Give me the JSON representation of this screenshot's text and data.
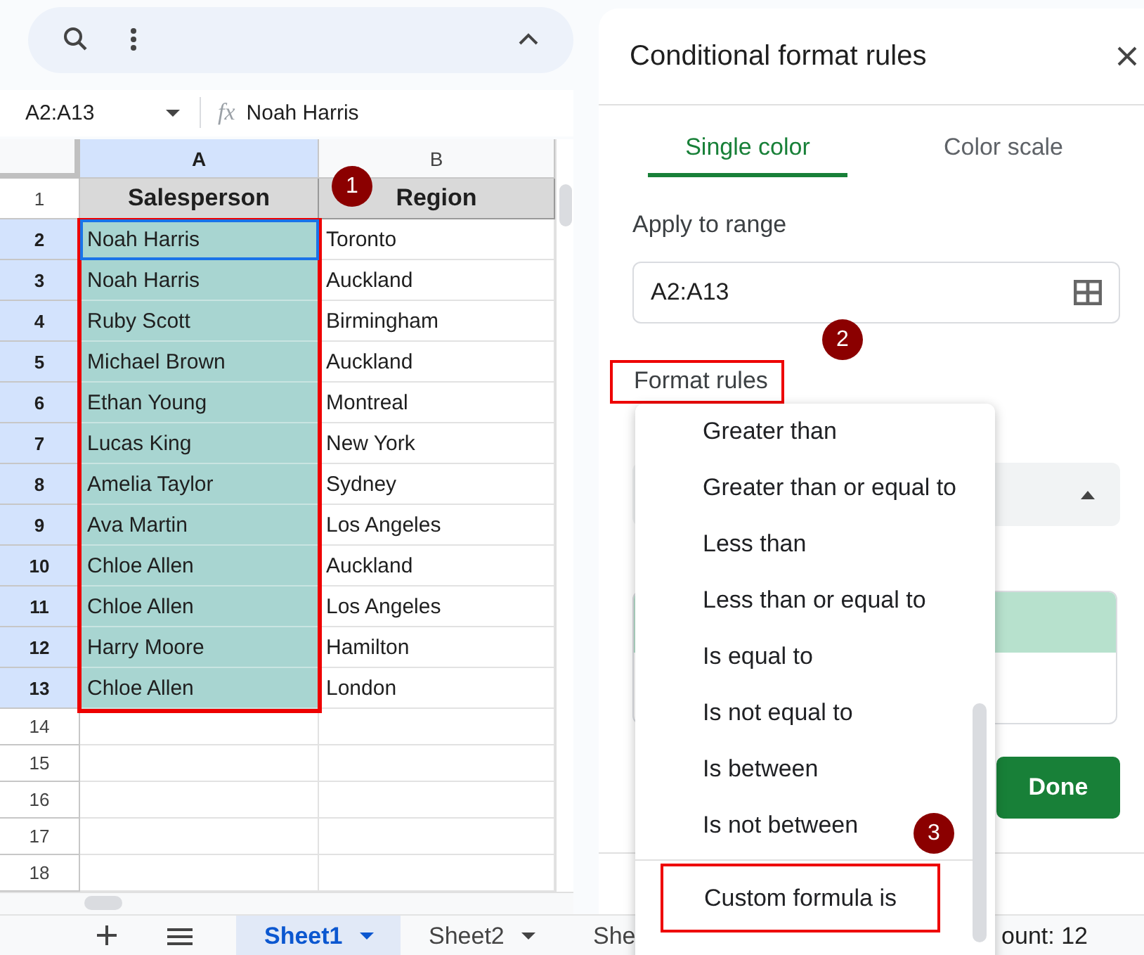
{
  "formula_bar": {
    "name_box": "A2:A13",
    "fx": "fx",
    "formula": "Noah Harris"
  },
  "columns": [
    {
      "label": "A",
      "selected": true
    },
    {
      "label": "B",
      "selected": false
    }
  ],
  "rows": [
    {
      "number": "1",
      "cells": [
        "Salesperson",
        "Region"
      ],
      "kind": "header",
      "selected": false,
      "active": false
    },
    {
      "number": "2",
      "cells": [
        "Noah Harris",
        "Toronto"
      ],
      "kind": "data",
      "selected": true,
      "active": true
    },
    {
      "number": "3",
      "cells": [
        "Noah Harris",
        "Auckland"
      ],
      "kind": "data",
      "selected": true,
      "active": false
    },
    {
      "number": "4",
      "cells": [
        "Ruby Scott",
        "Birmingham"
      ],
      "kind": "data",
      "selected": true,
      "active": false
    },
    {
      "number": "5",
      "cells": [
        "Michael Brown",
        "Auckland"
      ],
      "kind": "data",
      "selected": true,
      "active": false
    },
    {
      "number": "6",
      "cells": [
        "Ethan Young",
        "Montreal"
      ],
      "kind": "data",
      "selected": true,
      "active": false
    },
    {
      "number": "7",
      "cells": [
        "Lucas King",
        "New York"
      ],
      "kind": "data",
      "selected": true,
      "active": false
    },
    {
      "number": "8",
      "cells": [
        "Amelia Taylor",
        "Sydney"
      ],
      "kind": "data",
      "selected": true,
      "active": false
    },
    {
      "number": "9",
      "cells": [
        "Ava Martin",
        "Los Angeles"
      ],
      "kind": "data",
      "selected": true,
      "active": false
    },
    {
      "number": "10",
      "cells": [
        "Chloe Allen",
        "Auckland"
      ],
      "kind": "data",
      "selected": true,
      "active": false
    },
    {
      "number": "11",
      "cells": [
        "Chloe Allen",
        "Los Angeles"
      ],
      "kind": "data",
      "selected": true,
      "active": false
    },
    {
      "number": "12",
      "cells": [
        "Harry Moore",
        "Hamilton"
      ],
      "kind": "data",
      "selected": true,
      "active": false
    },
    {
      "number": "13",
      "cells": [
        "Chloe Allen",
        "London"
      ],
      "kind": "data",
      "selected": true,
      "active": false
    },
    {
      "number": "14",
      "cells": [],
      "kind": "data",
      "selected": false,
      "active": false
    },
    {
      "number": "15",
      "cells": [],
      "kind": "data",
      "selected": false,
      "active": false
    },
    {
      "number": "16",
      "cells": [],
      "kind": "data",
      "selected": false,
      "active": false
    },
    {
      "number": "17",
      "cells": [],
      "kind": "data",
      "selected": false,
      "active": false
    },
    {
      "number": "18",
      "cells": [],
      "kind": "data",
      "selected": false,
      "active": false
    }
  ],
  "panel": {
    "title": "Conditional format rules",
    "tabs": [
      {
        "label": "Single color",
        "selected": true
      },
      {
        "label": "Color scale",
        "selected": false
      }
    ],
    "apply_label": "Apply to range",
    "range_value": "A2:A13",
    "format_rules_label": {
      "text": "Format rules",
      "highlighted": true
    },
    "done_button": "Done"
  },
  "menu": {
    "items": [
      {
        "label": "Greater than",
        "highlighted": false,
        "separated": false
      },
      {
        "label": "Greater than or equal to",
        "highlighted": false,
        "separated": false
      },
      {
        "label": "Less than",
        "highlighted": false,
        "separated": false
      },
      {
        "label": "Less than or equal to",
        "highlighted": false,
        "separated": false
      },
      {
        "label": "Is equal to",
        "highlighted": false,
        "separated": false
      },
      {
        "label": "Is not equal to",
        "highlighted": false,
        "separated": false
      },
      {
        "label": "Is between",
        "highlighted": false,
        "separated": false
      },
      {
        "label": "Is not between",
        "highlighted": false,
        "separated": false
      },
      {
        "label": "Custom formula is",
        "highlighted": true,
        "separated": true
      }
    ]
  },
  "badges": [
    "1",
    "2",
    "3"
  ],
  "sheet_tabs": [
    {
      "label": "Sheet1",
      "selected": true
    },
    {
      "label": "Sheet2",
      "selected": false
    },
    {
      "label": "She",
      "selected": false
    }
  ],
  "status": "ount: 12"
}
